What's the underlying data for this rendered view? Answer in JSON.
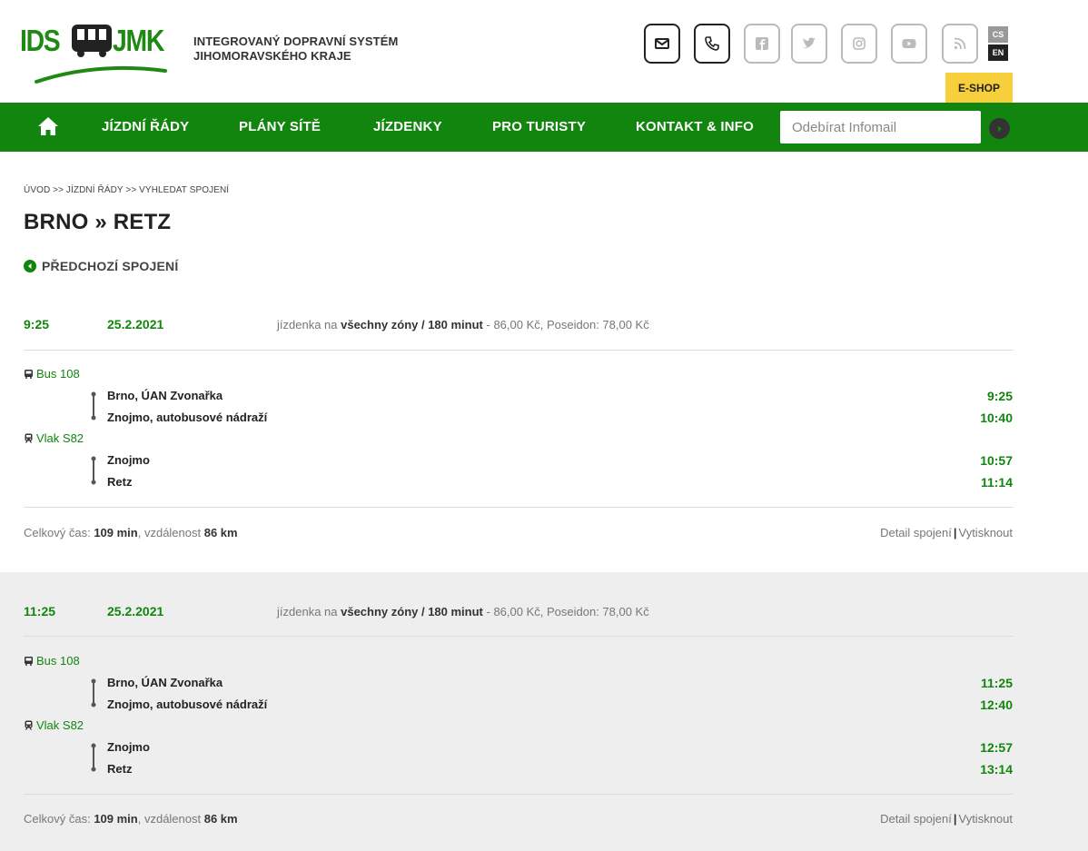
{
  "header": {
    "logo_left": "IDS",
    "logo_right": "JMK",
    "subtitle_line1": "INTEGROVANÝ DOPRAVNÍ SYSTÉM",
    "subtitle_line2": "JIHOMORAVSKÉHO KRAJE",
    "icons": [
      "mail-icon",
      "phone-icon",
      "facebook-icon",
      "twitter-icon",
      "instagram-icon",
      "youtube-icon",
      "rss-icon"
    ],
    "lang_cs": "CS",
    "lang_en": "EN",
    "eshop": "E-SHOP"
  },
  "nav": {
    "items": [
      "JÍZDNÍ ŘÁDY",
      "PLÁNY SÍTĚ",
      "JÍZDENKY",
      "PRO TURISTY",
      "KONTAKT & INFO"
    ],
    "infomail_placeholder": "Odebírat Infomail"
  },
  "breadcrumb": "ÚVOD >> JÍZDNÍ ŘÁDY >> VYHLEDAT SPOJENÍ",
  "page_title": "BRNO » RETZ",
  "prev_label": "PŘEDCHOZÍ SPOJENÍ",
  "connections": [
    {
      "time": "9:25",
      "date": "25.2.2021",
      "ticket_prefix": "jízdenka na ",
      "ticket_zones": "všechny zóny / 180 minut",
      "ticket_suffix": " - 86,00 Kč, Poseidon: 78,00 Kč",
      "legs": [
        {
          "line": "Bus 108",
          "from": "Brno, ÚAN Zvonařka",
          "from_time": "9:25",
          "to": "Znojmo, autobusové nádraží",
          "to_time": "10:40"
        },
        {
          "line": "Vlak S82",
          "from": "Znojmo",
          "from_time": "10:57",
          "to": "Retz",
          "to_time": "11:14"
        }
      ],
      "summary_prefix": "Celkový čas: ",
      "summary_time": "109 min",
      "summary_mid": ", vzdálenost ",
      "summary_dist": "86 km",
      "detail_link": "Detail spojení",
      "print_link": "Vytisknout"
    },
    {
      "time": "11:25",
      "date": "25.2.2021",
      "ticket_prefix": "jízdenka na ",
      "ticket_zones": "všechny zóny / 180 minut",
      "ticket_suffix": " - 86,00 Kč, Poseidon: 78,00 Kč",
      "legs": [
        {
          "line": "Bus 108",
          "from": "Brno, ÚAN Zvonařka",
          "from_time": "11:25",
          "to": "Znojmo, autobusové nádraží",
          "to_time": "12:40"
        },
        {
          "line": "Vlak S82",
          "from": "Znojmo",
          "from_time": "12:57",
          "to": "Retz",
          "to_time": "13:14"
        }
      ],
      "summary_prefix": "Celkový čas: ",
      "summary_time": "109 min",
      "summary_mid": ", vzdálenost ",
      "summary_dist": "86 km",
      "detail_link": "Detail spojení",
      "print_link": "Vytisknout"
    }
  ],
  "colors": {
    "brand_green": "#12850e",
    "eshop_yellow": "#f6cf3a",
    "alt_row": "#eeeeee"
  }
}
